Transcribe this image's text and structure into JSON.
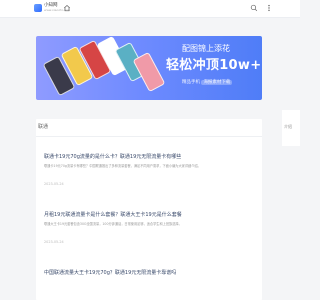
{
  "header": {
    "logo_text": "小知网",
    "logo_sub": "www.xiaozhi.com",
    "icons": [
      "home-icon",
      "search-icon",
      "menu-icon"
    ],
    "accent_color": "#2f6bff"
  },
  "banner": {
    "line1": "配图锦上添花",
    "line2": "轻松冲顶10w+",
    "line3_prefix": "精品手机",
    "line3_highlight": "海报素材下载",
    "gradient": [
      "#8f9bff",
      "#4f7df7"
    ]
  },
  "section": {
    "title": "联通",
    "articles": [
      {
        "title": "联通卡19元70g流量的是什么卡？联通19元无限流量卡有哪些",
        "summary": "联通卡19元70g流量卡有哪些？中国联通推出了多种流量套餐，满足不同用户需求，下面小编为大家详细介绍。",
        "date": "2023-05-24"
      },
      {
        "title": "月租19元联通流量卡是什么套餐？联通大王卡19元是什么套餐",
        "summary": "联通大王卡19元套餐包含30G全国流量，100分钟通话，日常使用足够，适合学生和上班族选择。",
        "date": "2023-05-24"
      },
      {
        "title": "中国联通流量大王卡19元70g？联通19元无限流量卡靠谱吗",
        "summary": "",
        "date": ""
      }
    ]
  },
  "sidebar": {
    "card_text": "介绍"
  }
}
